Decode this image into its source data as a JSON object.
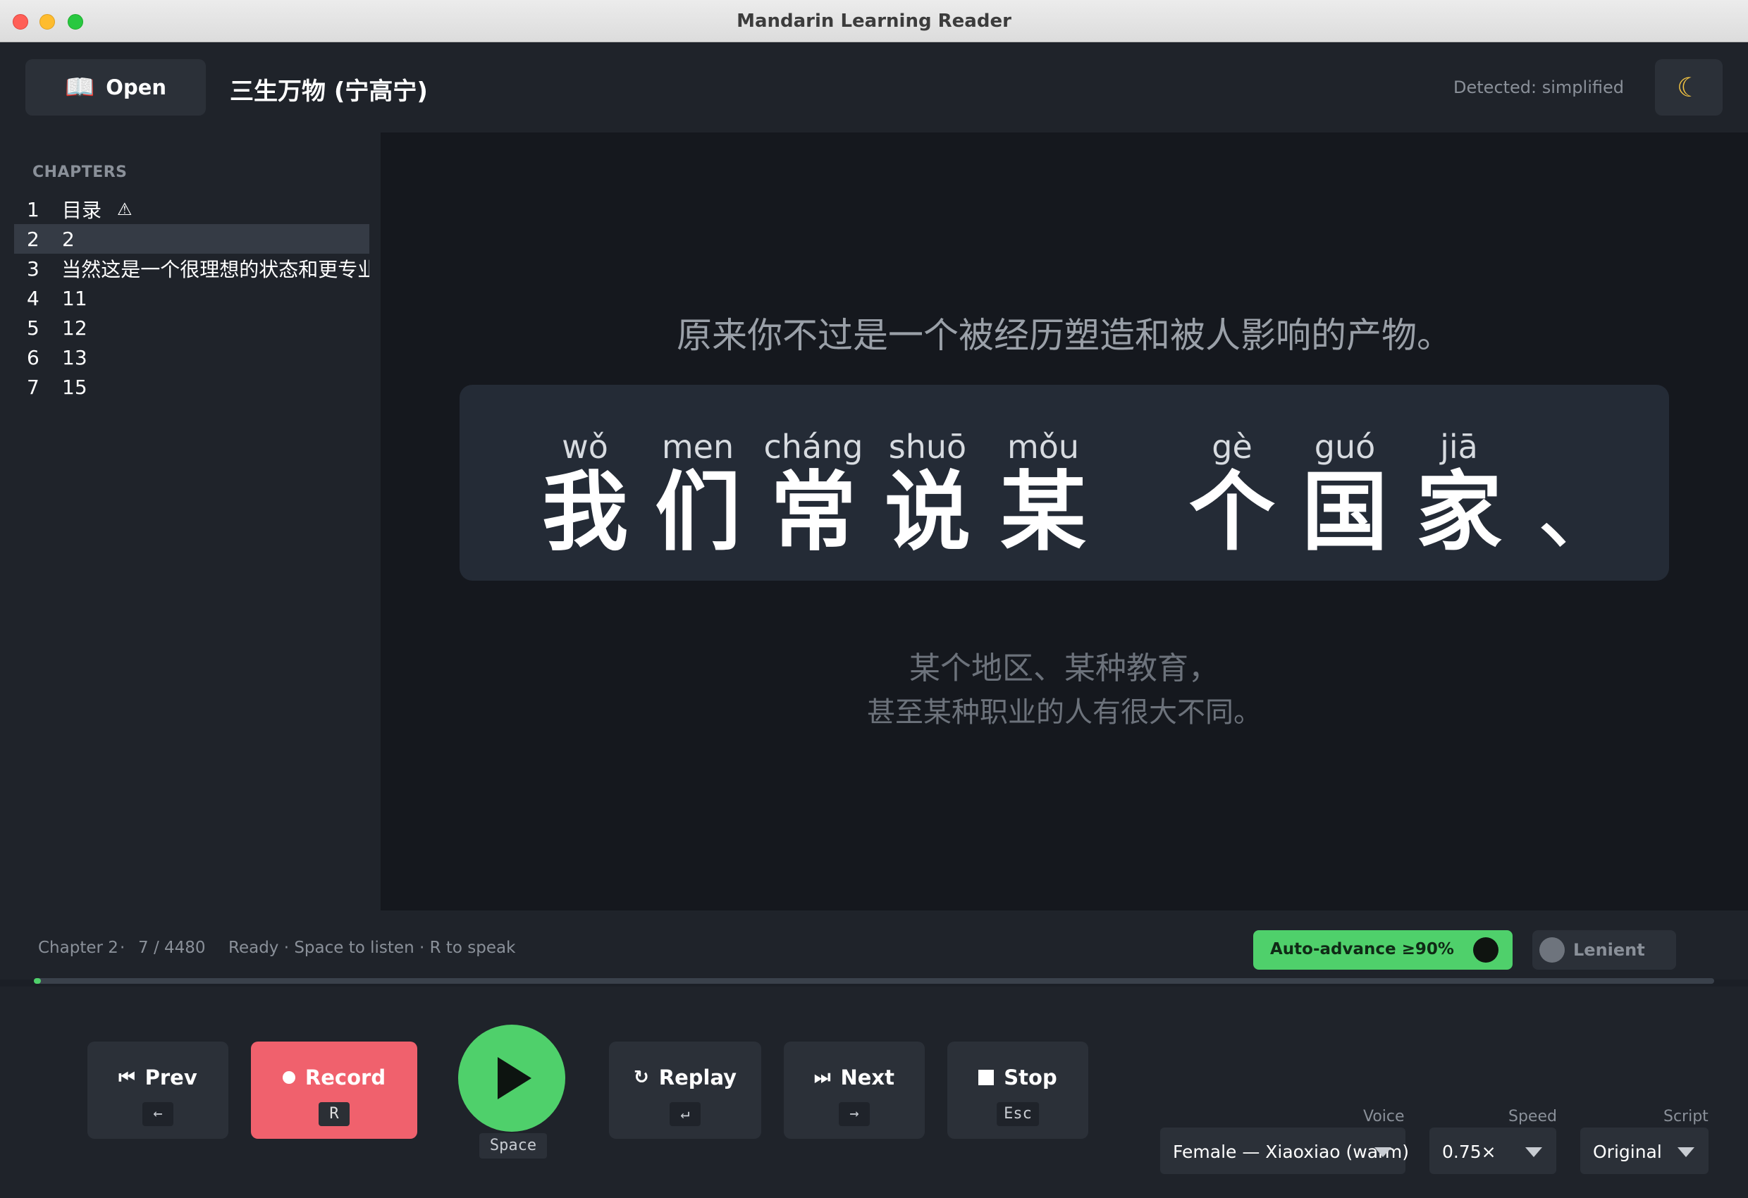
{
  "window": {
    "title": "Mandarin Learning Reader"
  },
  "header": {
    "open_label": "Open",
    "open_icon": "book-icon",
    "book_title": "三生万物 (宁高宁)",
    "detected": "Detected: simplified",
    "theme_icon": "moon-icon"
  },
  "sidebar": {
    "heading": "CHAPTERS",
    "chapters": [
      {
        "num": "1",
        "title": "目录",
        "warning": "⚠"
      },
      {
        "num": "2",
        "title": "2",
        "active": true
      },
      {
        "num": "3",
        "title": "当然这是一个很理想的状态和更专业"
      },
      {
        "num": "4",
        "title": "11"
      },
      {
        "num": "5",
        "title": "12"
      },
      {
        "num": "6",
        "title": "13"
      },
      {
        "num": "7",
        "title": "15"
      }
    ]
  },
  "reader": {
    "previous_sentence": "原来你不过是一个被经历塑造和被人影响的产物。",
    "current": [
      {
        "pinyin": "wǒ",
        "hanzi": "我"
      },
      {
        "pinyin": "men",
        "hanzi": "们"
      },
      {
        "pinyin": "cháng",
        "hanzi": "常"
      },
      {
        "pinyin": "shuō",
        "hanzi": "说"
      },
      {
        "pinyin": "mǒu",
        "hanzi": "某"
      },
      {
        "pinyin": "gè",
        "hanzi": "个"
      },
      {
        "pinyin": "guó",
        "hanzi": "国"
      },
      {
        "pinyin": "jiā",
        "hanzi": "家"
      }
    ],
    "current_punct": "、",
    "next_lines": [
      "某个地区、某种教育，",
      "甚至某种职业的人有很大不同。"
    ]
  },
  "status": {
    "chapter": "Chapter 2",
    "separator": "·",
    "position": "7 / 4480",
    "message": "Ready · Space to listen · R to speak",
    "progress_fraction": 0.0016,
    "auto_advance_label": "Auto-advance ≥90%",
    "auto_advance_on": true,
    "lenient_label": "Lenient",
    "lenient_on": false
  },
  "controls": {
    "prev": {
      "label": "Prev",
      "icon": "⏮",
      "key": "←"
    },
    "record": {
      "label": "Record",
      "key": "R"
    },
    "play": {
      "key": "Space"
    },
    "replay": {
      "label": "Replay",
      "icon": "↻",
      "key": "↵"
    },
    "next": {
      "label": "Next",
      "icon": "⏭",
      "key": "→"
    },
    "stop": {
      "label": "Stop",
      "key": "Esc"
    }
  },
  "settings": {
    "voice_label": "Voice",
    "voice_value": "Female — Xiaoxiao (warm)",
    "speed_label": "Speed",
    "speed_value": "0.75×",
    "script_label": "Script",
    "script_value": "Original"
  },
  "colors": {
    "accent_green": "#4fd06b",
    "record_red": "#f0616d",
    "background": "#15181e"
  }
}
